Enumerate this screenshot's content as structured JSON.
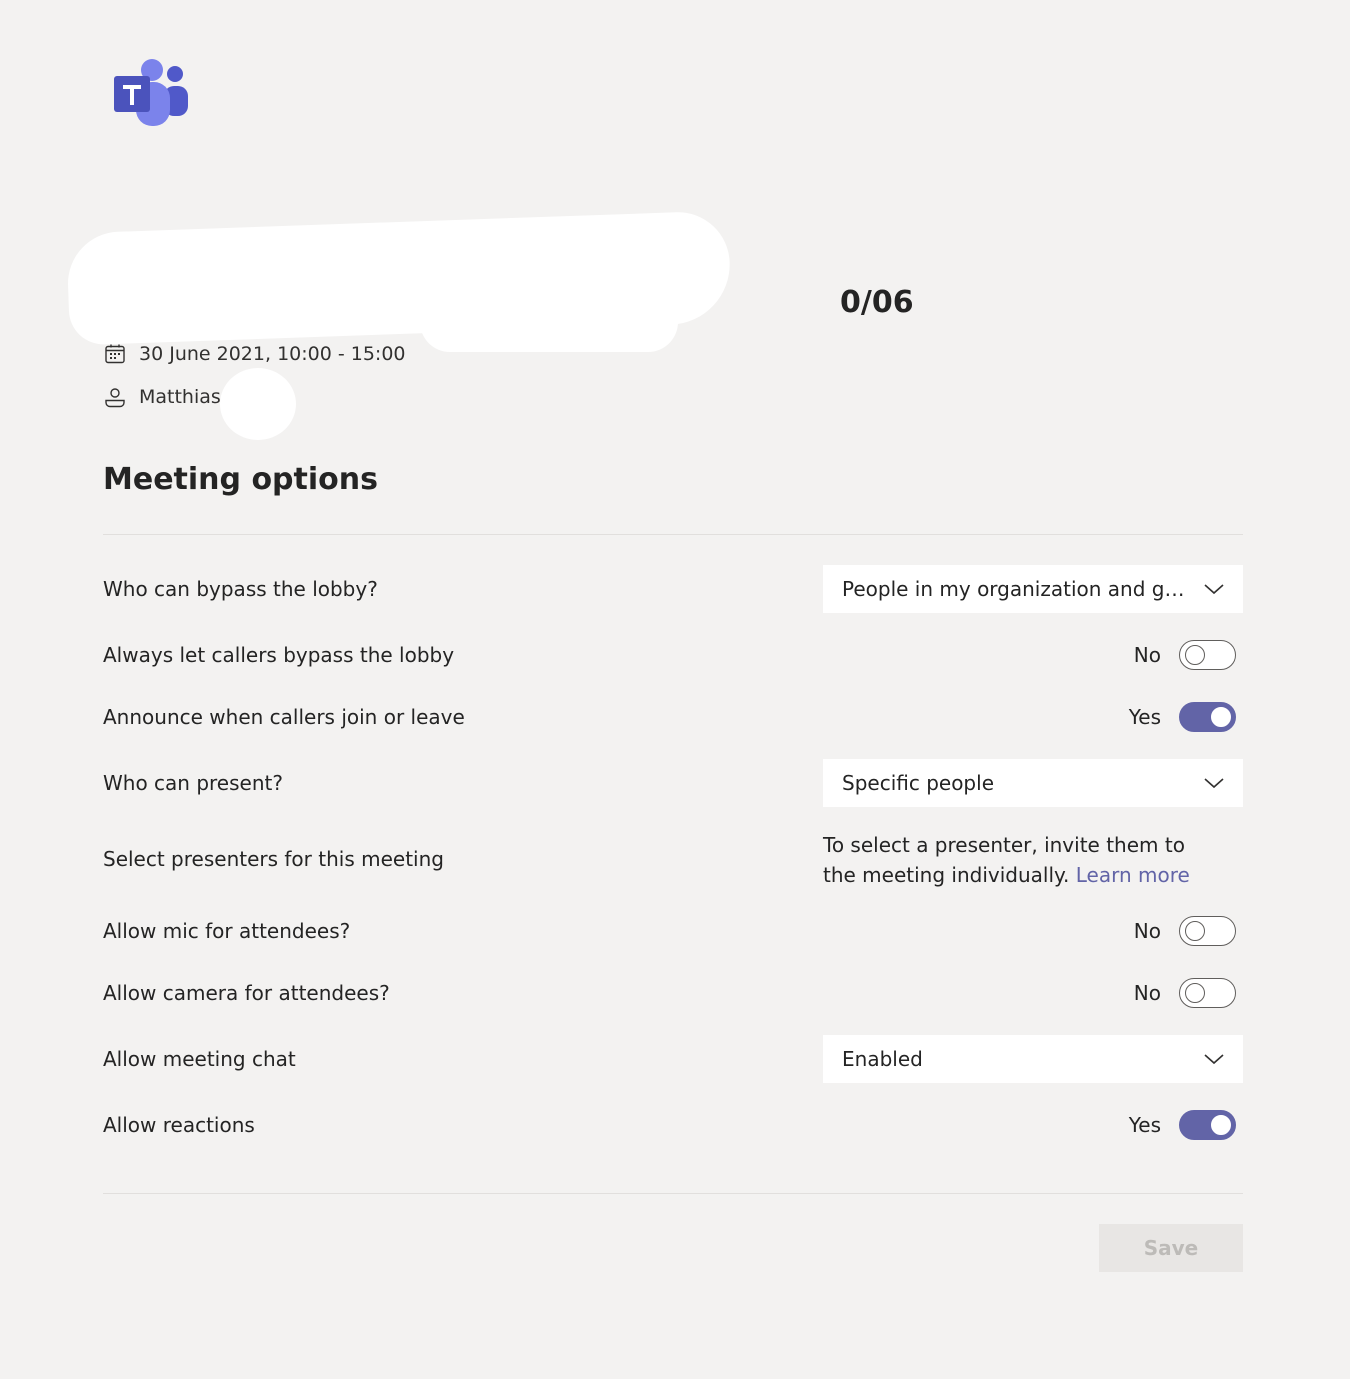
{
  "meeting": {
    "title": "0/06",
    "date": "30 June 2021, 10:00 - 15:00",
    "organizer": "Matthias"
  },
  "section_title": "Meeting options",
  "colors": {
    "accent": "#6264a7",
    "background": "#f3f2f1",
    "divider": "#e1dfdd"
  },
  "options": {
    "bypass_lobby": {
      "label": "Who can bypass the lobby?",
      "value": "People in my organization and gu..."
    },
    "callers_bypass": {
      "label": "Always let callers bypass the lobby",
      "state": "No",
      "on": false
    },
    "announce_callers": {
      "label": "Announce when callers join or leave",
      "state": "Yes",
      "on": true
    },
    "who_can_present": {
      "label": "Who can present?",
      "value": "Specific people"
    },
    "select_presenters": {
      "label": "Select presenters for this meeting",
      "info": "To select a presenter, invite them to the meeting individually.",
      "link": "Learn more"
    },
    "allow_mic": {
      "label": "Allow mic for attendees?",
      "state": "No",
      "on": false
    },
    "allow_camera": {
      "label": "Allow camera for attendees?",
      "state": "No",
      "on": false
    },
    "meeting_chat": {
      "label": "Allow meeting chat",
      "value": "Enabled"
    },
    "reactions": {
      "label": "Allow reactions",
      "state": "Yes",
      "on": true
    }
  },
  "save_label": "Save"
}
